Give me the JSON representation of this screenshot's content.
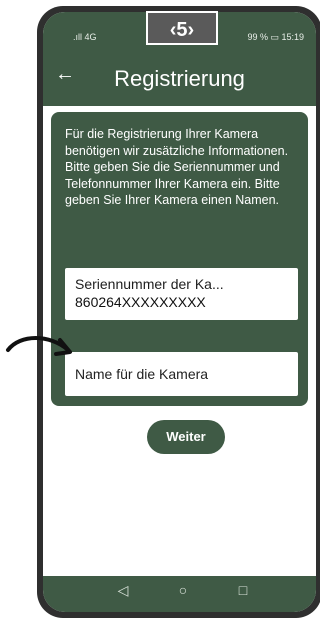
{
  "step": {
    "label": "‹5›"
  },
  "status_bar": {
    "signal": ".ıll 4G",
    "right": "99 % ▭ 15:19"
  },
  "app_bar": {
    "back_icon": "arrow-left-icon",
    "title": "Registrierung"
  },
  "card": {
    "info": "Für die Registrierung Ihrer Kamera benötigen wir zusätzliche Informationen. Bitte geben Sie die Seriennummer und Telefonnummer Ihrer Kamera ein. Bitte geben Sie Ihrer Kamera einen Namen."
  },
  "serial_field": {
    "label": "Seriennummer der Ka...",
    "value": "860264XXXXXXXXX"
  },
  "name_field": {
    "placeholder": "Name für die Kamera"
  },
  "continue_button": {
    "label": "Weiter"
  },
  "colors": {
    "primary": "#3f5a45",
    "badge": "#5a5a5a"
  },
  "nav": {
    "back": "◁",
    "home": "○",
    "recent": "□"
  }
}
